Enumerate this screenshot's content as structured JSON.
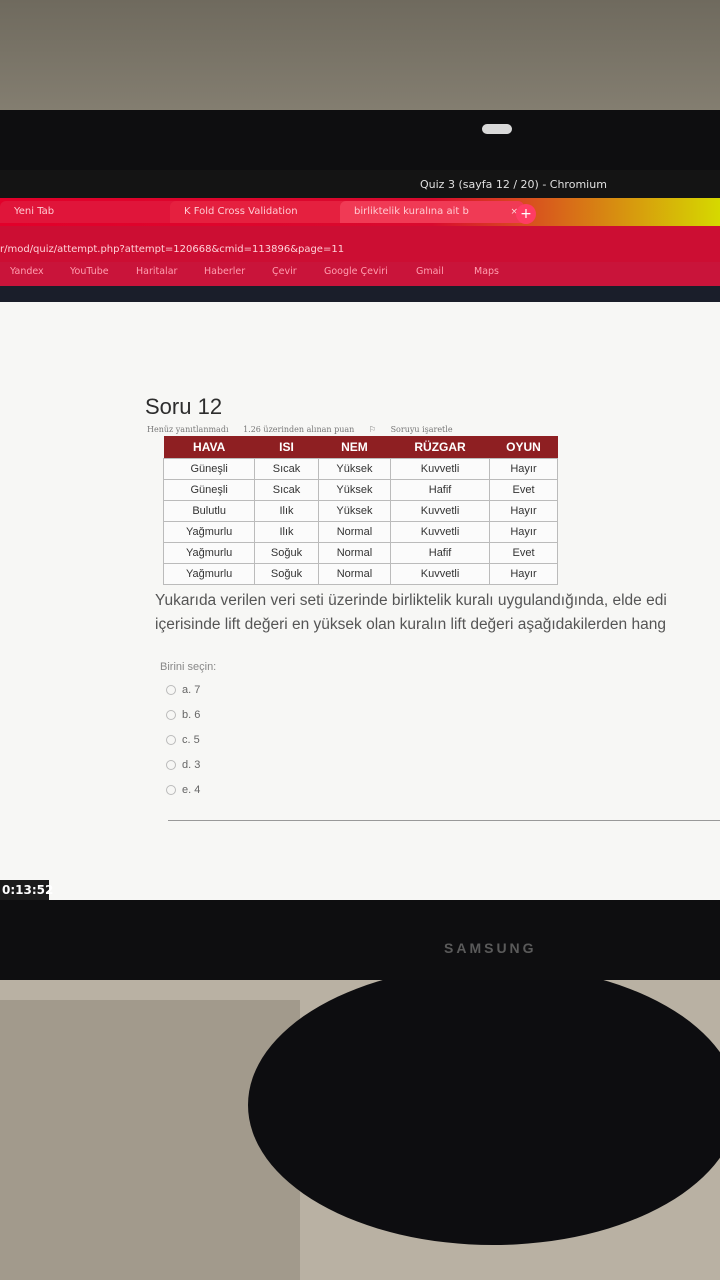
{
  "browser": {
    "window_title": "Quiz 3 (sayfa 12 / 20) - Chromium",
    "tabs": [
      {
        "label": "Yeni Tab",
        "close": "×"
      },
      {
        "label": "K Fold Cross Validation",
        "close": "×"
      },
      {
        "label": "birliktelik kuralına ait b",
        "close": "×"
      }
    ],
    "new_tab": "+",
    "url": "r/mod/quiz/attempt.php?attempt=120668&cmid=113896&page=11",
    "bookmarks": [
      "Yandex",
      "YouTube",
      "Haritalar",
      "Haberler",
      "Çevir",
      "Google Çeviri",
      "Gmail",
      "Maps"
    ]
  },
  "question": {
    "title": "Soru 12",
    "status": "Henüz yanıtlanmadı",
    "points": "1.26 üzerinden alınan puan",
    "flag": "Soruyu işaretle",
    "table_headers": [
      "HAVA",
      "ISI",
      "NEM",
      "RÜZGAR",
      "OYUN"
    ],
    "table_rows": [
      [
        "Güneşli",
        "Sıcak",
        "Yüksek",
        "Kuvvetli",
        "Hayır"
      ],
      [
        "Güneşli",
        "Sıcak",
        "Yüksek",
        "Hafif",
        "Evet"
      ],
      [
        "Bulutlu",
        "Ilık",
        "Yüksek",
        "Kuvvetli",
        "Hayır"
      ],
      [
        "Yağmurlu",
        "Ilık",
        "Normal",
        "Kuvvetli",
        "Hayır"
      ],
      [
        "Yağmurlu",
        "Soğuk",
        "Normal",
        "Hafif",
        "Evet"
      ],
      [
        "Yağmurlu",
        "Soğuk",
        "Normal",
        "Kuvvetli",
        "Hayır"
      ]
    ],
    "text_line1": "Yukarıda verilen veri seti üzerinde birliktelik kuralı uygulandığında, elde edi",
    "text_line2": "içerisinde lift değeri en yüksek olan kuralın lift değeri aşağıdakilerden hang",
    "prompt": "Birini seçin:",
    "options": [
      "a. 7",
      "b. 6",
      "c. 5",
      "d. 3",
      "e. 4"
    ]
  },
  "timer": "0:13:52",
  "monitor_brand": "SAMSUNG"
}
